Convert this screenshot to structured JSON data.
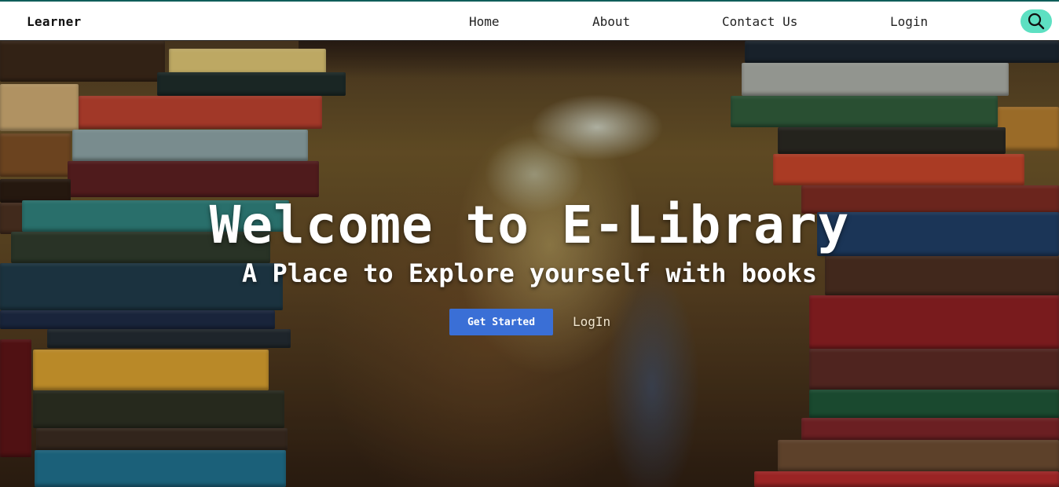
{
  "nav": {
    "brand": "Learner",
    "links": [
      {
        "label": "Home"
      },
      {
        "label": "About"
      },
      {
        "label": "Contact Us"
      },
      {
        "label": "Login"
      }
    ],
    "search_icon": "search-icon",
    "search_color": "#5de0c2"
  },
  "hero": {
    "title": "Welcome to E-Library",
    "subtitle": "A Place to Explore yourself with books",
    "primary_cta": "Get Started",
    "secondary_cta": "LogIn",
    "primary_color": "#3a6fd6"
  }
}
